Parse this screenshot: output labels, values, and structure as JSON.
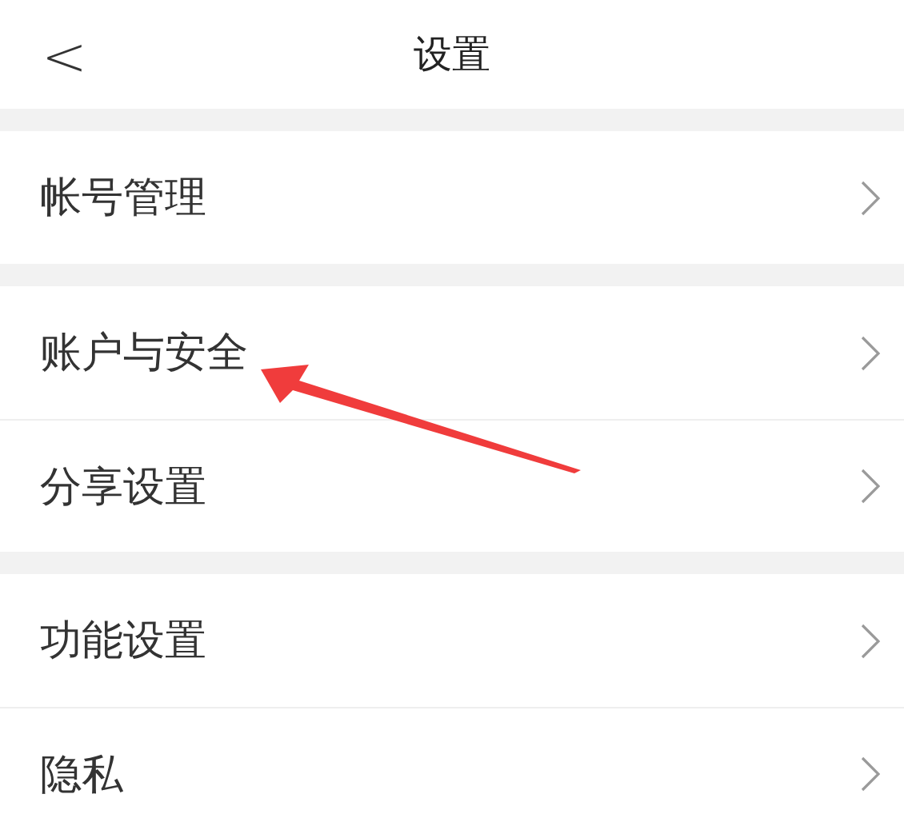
{
  "header": {
    "back": "<",
    "title": "设置"
  },
  "groups": [
    {
      "rows": [
        {
          "label": "帐号管理",
          "pointed": false
        }
      ]
    },
    {
      "rows": [
        {
          "label": "账户与安全",
          "pointed": true
        },
        {
          "label": "分享设置",
          "pointed": false
        }
      ]
    },
    {
      "rows": [
        {
          "label": "功能设置",
          "pointed": false
        },
        {
          "label": "隐私",
          "pointed": false
        }
      ]
    }
  ]
}
